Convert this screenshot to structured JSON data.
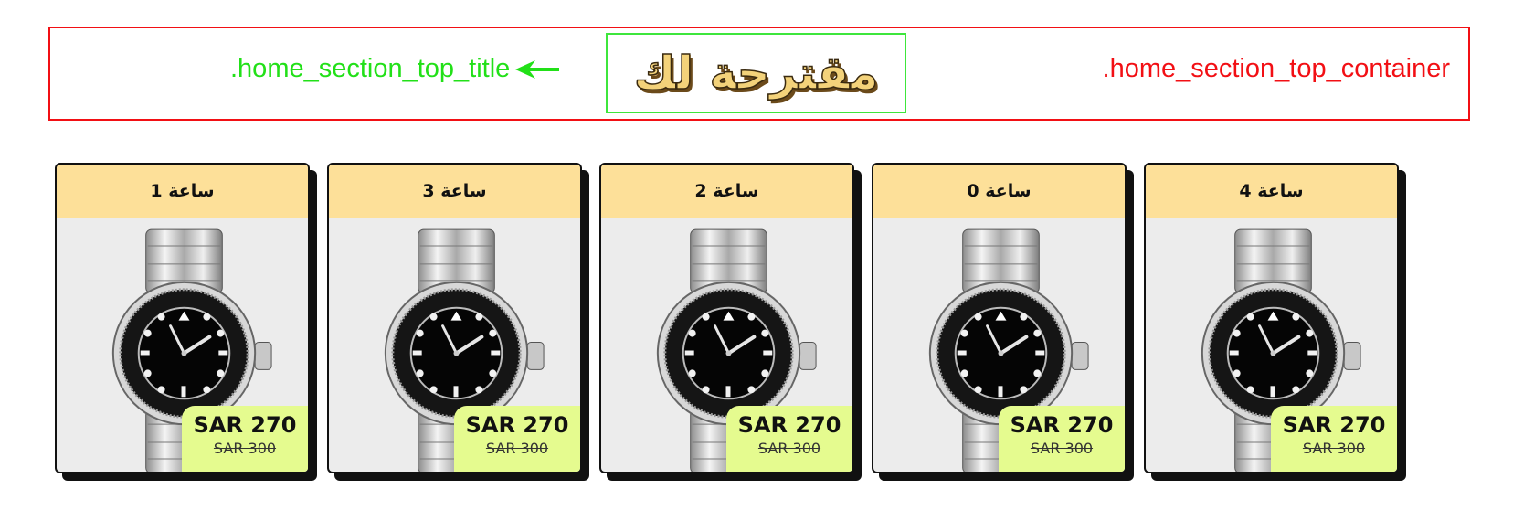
{
  "top": {
    "container_label": ".home_section_top_container",
    "title": "مقترحة لك",
    "title_label": ".home_section_top_title"
  },
  "colors": {
    "container_border": "#f20f14",
    "title_border": "#3ee63c",
    "title_label": "#22e018",
    "card_header": "#fde099",
    "price_box": "#e5fb8f"
  },
  "products": [
    {
      "name": "ساعة 1",
      "price": "SAR 270",
      "old_price": "SAR 300",
      "icon": "watch-icon"
    },
    {
      "name": "ساعة 3",
      "price": "SAR 270",
      "old_price": "SAR 300",
      "icon": "watch-icon"
    },
    {
      "name": "ساعة 2",
      "price": "SAR 270",
      "old_price": "SAR 300",
      "icon": "watch-icon"
    },
    {
      "name": "ساعة 0",
      "price": "SAR 270",
      "old_price": "SAR 300",
      "icon": "watch-icon"
    },
    {
      "name": "ساعة 4",
      "price": "SAR 270",
      "old_price": "SAR 300",
      "icon": "watch-icon"
    }
  ]
}
